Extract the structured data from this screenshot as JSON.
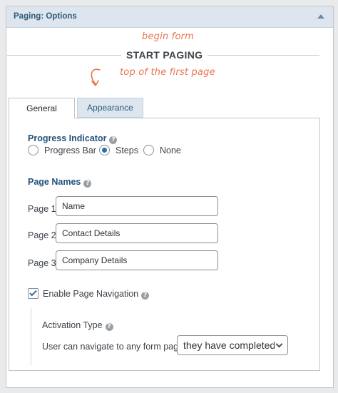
{
  "panel": {
    "title": "Paging: Options"
  },
  "canvas": {
    "begin_form_note": "begin form",
    "start_paging_label": "START PAGING",
    "top_first_page_note": "top of the first page"
  },
  "tabs": [
    {
      "label": "General",
      "active": true
    },
    {
      "label": "Appearance",
      "active": false
    }
  ],
  "progress_indicator": {
    "label": "Progress Indicator",
    "options": [
      {
        "label": "Progress Bar",
        "checked": false
      },
      {
        "label": "Steps",
        "checked": true
      },
      {
        "label": "None",
        "checked": false
      }
    ]
  },
  "page_names": {
    "label": "Page Names",
    "pages": [
      {
        "label": "Page 1",
        "value": "Name"
      },
      {
        "label": "Page 2",
        "value": "Contact Details"
      },
      {
        "label": "Page 3",
        "value": "Company Details"
      }
    ]
  },
  "navigation": {
    "enable_label": "Enable Page Navigation",
    "enabled": true,
    "activation_type_label": "Activation Type",
    "nav_text": "User can navigate to any form page",
    "select_value": "they have completed"
  },
  "colors": {
    "accent": "#2271b1",
    "handwriting": "#e9744a",
    "section_label": "#23527a",
    "header_bg": "#dde6ee"
  },
  "icons": {
    "collapse": "chevron-up-icon",
    "help": "question-circle-icon",
    "curl_arrow": "curved-arrow-icon",
    "select_caret": "chevron-down-icon"
  }
}
